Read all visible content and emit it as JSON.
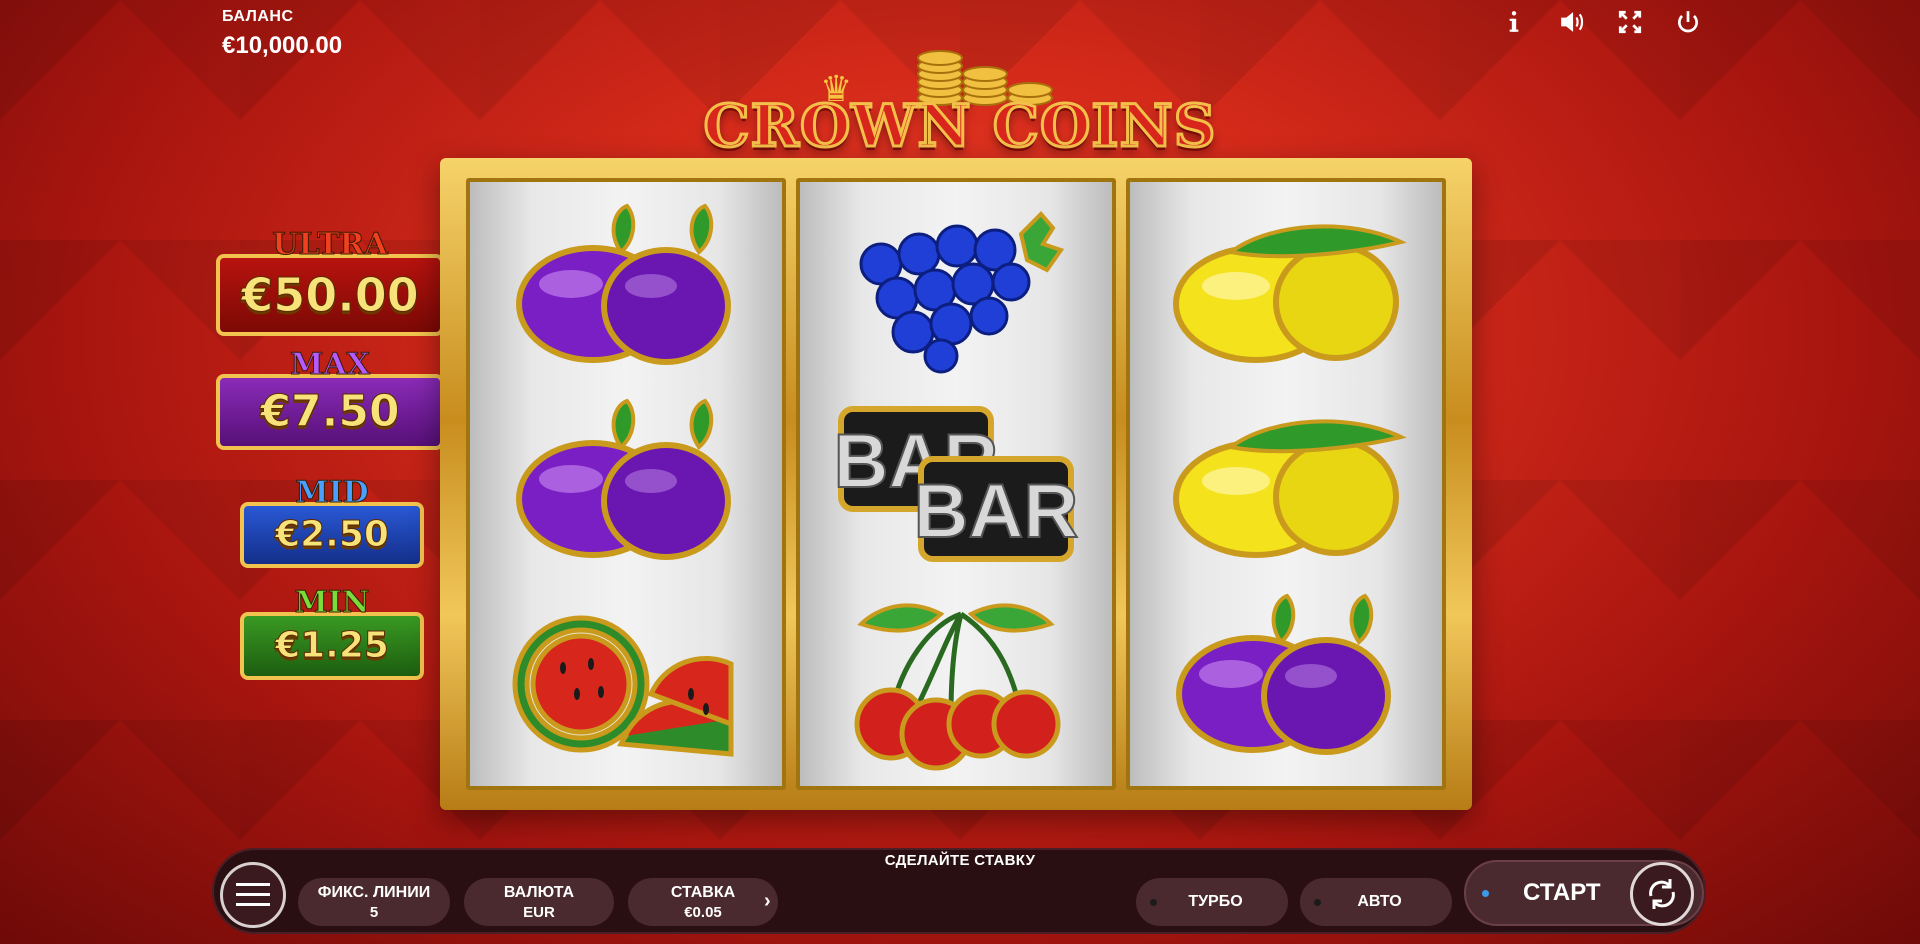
{
  "header": {
    "balance_label": "БАЛАНС",
    "balance_value": "€10,000.00",
    "icons": [
      "info-icon",
      "sound-icon",
      "fullscreen-icon",
      "power-icon"
    ]
  },
  "logo": {
    "title": "CROWN COINS"
  },
  "jackpots": {
    "ultra": {
      "name": "ULTRA",
      "value": "€50.00",
      "color": "#b8130e"
    },
    "max": {
      "name": "MAX",
      "value": "€7.50",
      "color": "#8a2bb8"
    },
    "mid": {
      "name": "MID",
      "value": "€2.50",
      "color": "#2a58d4"
    },
    "min": {
      "name": "MIN",
      "value": "€1.25",
      "color": "#3a9a23"
    }
  },
  "reels": [
    [
      "plum",
      "plum",
      "watermelon"
    ],
    [
      "grapes",
      "bar",
      "cherries"
    ],
    [
      "lemon",
      "lemon",
      "plum"
    ]
  ],
  "bar_symbol": {
    "text": "BAR"
  },
  "bottom": {
    "prompt": "СДЕЛАЙТЕ СТАВКУ",
    "lines_label": "ФИКС. ЛИНИИ",
    "lines_value": "5",
    "currency_label": "ВАЛЮТА",
    "currency_value": "EUR",
    "stake_label": "СТАВКА",
    "stake_value": "€0.05",
    "turbo_label": "ТУРБО",
    "auto_label": "АВТО",
    "start_label": "СТАРТ"
  }
}
